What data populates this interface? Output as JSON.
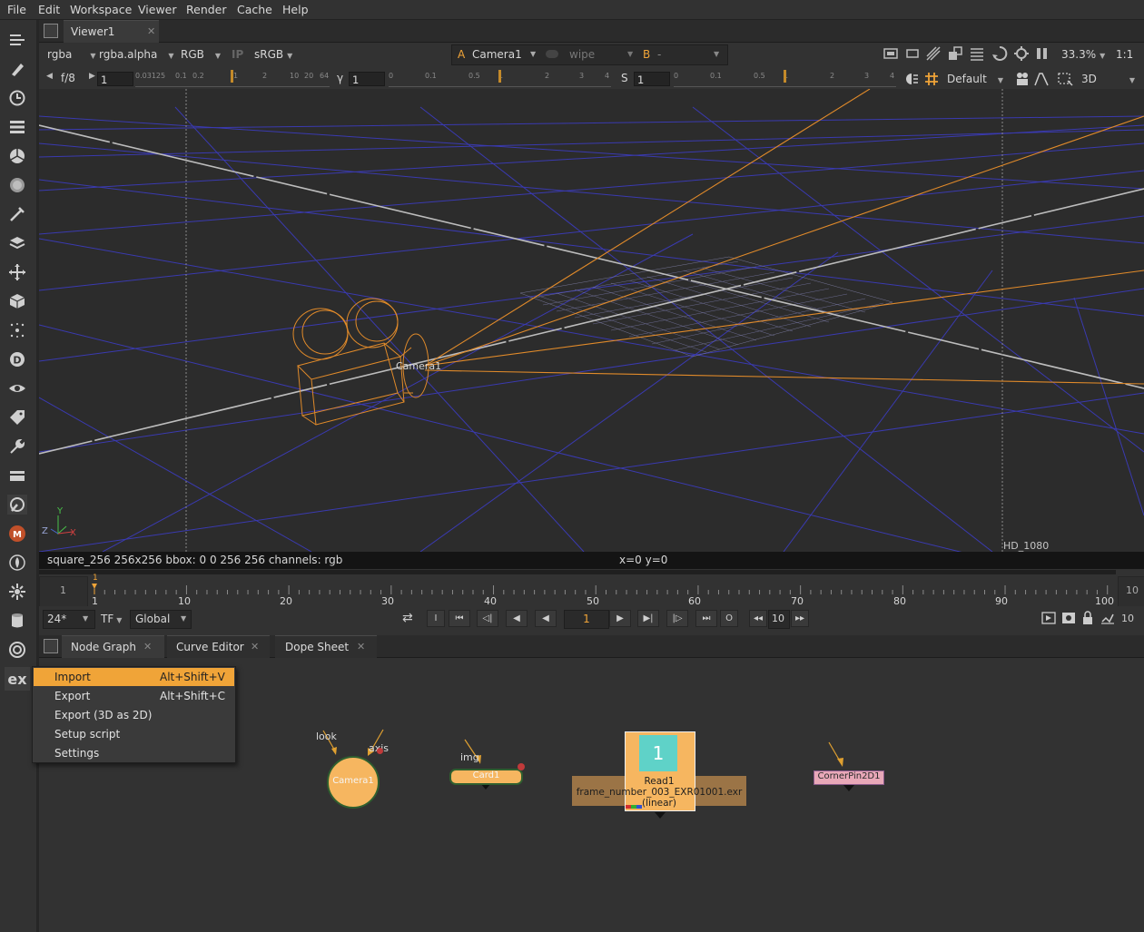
{
  "menubar": {
    "items": [
      "File",
      "Edit",
      "Workspace",
      "Viewer",
      "Render",
      "Cache",
      "Help"
    ]
  },
  "toolbar": {
    "tools": [
      "image-icon",
      "draw-icon",
      "time-icon",
      "channel-icon",
      "color-icon",
      "filter-icon",
      "keyer-icon",
      "merge-icon",
      "transform-icon",
      "3d-icon",
      "particles-icon",
      "deep-icon",
      "views-icon",
      "metadata-icon",
      "toolsets-icon",
      "other-icon",
      "furnace-icon",
      "mocha-icon",
      "fire-icon",
      "splat-icon",
      "cup-icon",
      "cara-icon"
    ],
    "ex_label": "ex"
  },
  "viewer": {
    "tab_label": "Viewer1",
    "channels": "rgba",
    "alpha": "rgba.alpha",
    "colorspace": "RGB",
    "ip_label": "IP",
    "lut": "sRGB",
    "input_a_label": "A",
    "input_a_value": "Camera1",
    "wipe_label": "wipe",
    "input_b_label": "B",
    "input_b_value": "-",
    "zoom": "33.3%",
    "ratio": "1:1",
    "fstop": "f/8",
    "gain_value": "1",
    "gamma_label": "γ",
    "gamma_value": "1",
    "s_label": "S",
    "s_value": "1",
    "gain_ticks": [
      "0.03125",
      "0.1",
      "0.2",
      "1",
      "2",
      "10",
      "20",
      "64"
    ],
    "gamma_ticks": [
      "0",
      "0.1",
      "0.5",
      "1",
      "2",
      "3",
      "4"
    ],
    "s_ticks": [
      "0",
      "0.1",
      "0.5",
      "1",
      "2",
      "3",
      "4"
    ],
    "display_mode": "Default",
    "view_mode": "3D",
    "format_label": "HD_1080",
    "camera_label": "Camera1",
    "axis_y": "Y",
    "axis_z": "Z",
    "axis_x": "X",
    "info_left": "square_256 256x256  bbox: 0 0 256 256 channels: rgb",
    "info_center": "x=0 y=0"
  },
  "timeline": {
    "start": "1",
    "end": "10",
    "current_marker": "1",
    "ticks": [
      "1",
      "10",
      "20",
      "30",
      "40",
      "50",
      "60",
      "70",
      "80",
      "90",
      "100"
    ],
    "fps": "24*",
    "tf": "TF",
    "scope": "Global",
    "current_frame": "1",
    "in_btn": "I",
    "out_btn": "O",
    "step": "10",
    "end_right": "10"
  },
  "nodegraph_tabs": [
    {
      "label": "Node Graph"
    },
    {
      "label": "Curve Editor"
    },
    {
      "label": "Dope Sheet"
    }
  ],
  "context_menu": {
    "items": [
      {
        "label": "Import",
        "shortcut": "Alt+Shift+V"
      },
      {
        "label": "Export",
        "shortcut": "Alt+Shift+C"
      },
      {
        "label": "Export (3D as 2D)",
        "shortcut": ""
      },
      {
        "label": "Setup script",
        "shortcut": ""
      },
      {
        "label": "Settings",
        "shortcut": ""
      }
    ]
  },
  "nodes": {
    "camera": {
      "name": "Camera1",
      "input_look": "look",
      "input_axis": "axis"
    },
    "card": {
      "name": "Card1",
      "input_img": "img"
    },
    "read": {
      "name": "Read1",
      "frame": "1",
      "file": "frame_number_003_EXR01001.exr",
      "colorspace": "(linear)"
    },
    "cornerpin": {
      "name": "CornerPin2D1"
    }
  },
  "colors": {
    "accent": "#f0a438",
    "grid": "#3a3ab0",
    "camera": "#e08a2a",
    "read_node": "#f6b660",
    "read_thumb": "#5fd2c8"
  }
}
